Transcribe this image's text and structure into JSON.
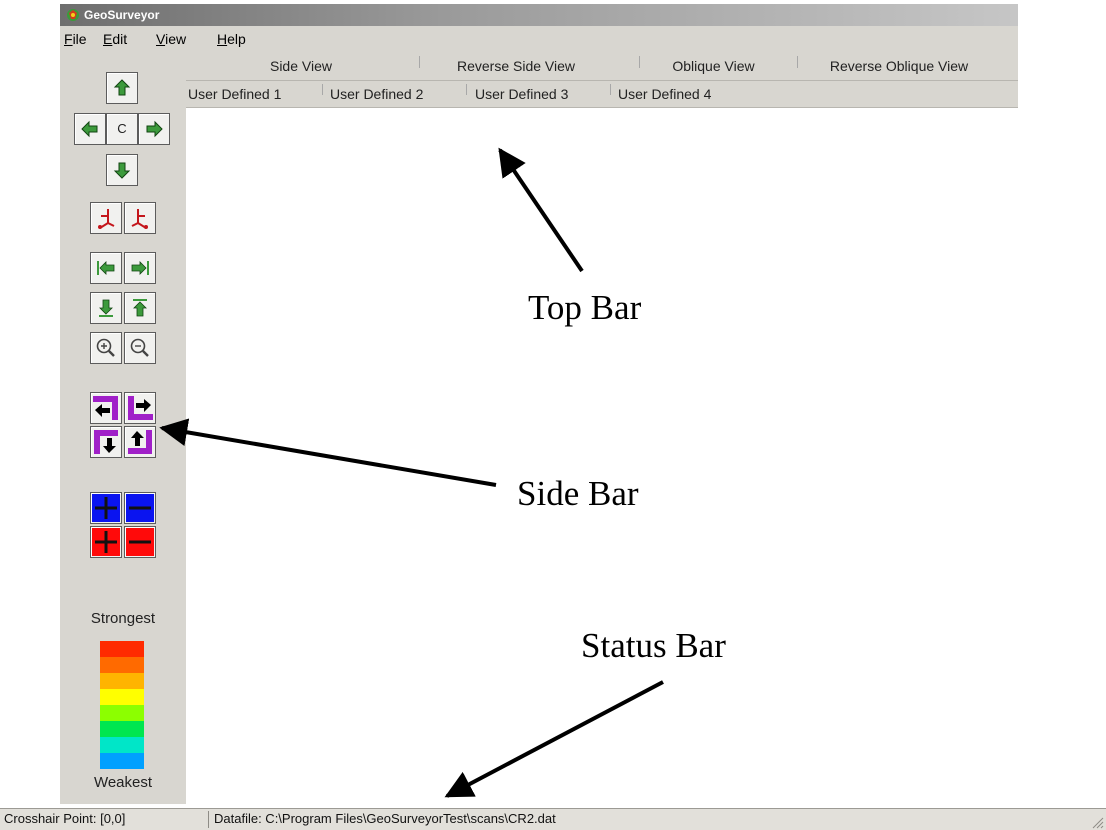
{
  "window": {
    "title": "GeoSurveyor"
  },
  "menu": {
    "items": [
      {
        "hotkey": "F",
        "rest": "ile"
      },
      {
        "hotkey": "E",
        "rest": "dit"
      },
      {
        "hotkey": "V",
        "rest": "iew"
      },
      {
        "hotkey": "H",
        "rest": "elp"
      }
    ]
  },
  "sidebar": {
    "center_label": "C",
    "legend": {
      "top_label": "Strongest",
      "bottom_label": "Weakest",
      "colors": [
        "#ff2a00",
        "#ff6a00",
        "#ffb400",
        "#ffff00",
        "#8cff00",
        "#00e650",
        "#00e6c8",
        "#00a0ff",
        "#0030ff"
      ]
    },
    "intensity_colors": {
      "blue": "#0a14f0",
      "red": "#ff0a0a"
    },
    "shift_color": "#a020c8",
    "icons": [
      "up-arrow-icon",
      "left-arrow-icon",
      "right-arrow-icon",
      "down-arrow-icon",
      "rotate-left-icon",
      "rotate-right-icon",
      "first-scan-icon",
      "last-scan-icon",
      "move-down-icon",
      "move-up-icon",
      "zoom-in-icon",
      "zoom-out-icon",
      "shift-left-icon",
      "shift-right-icon",
      "shift-down-icon",
      "shift-up-icon",
      "blue-plus-icon",
      "blue-minus-icon",
      "red-plus-icon",
      "red-minus-icon"
    ]
  },
  "view_tabs": [
    "Side View",
    "Reverse Side View",
    "Oblique View",
    "Reverse Oblique View"
  ],
  "user_tabs": [
    "User Defined 1",
    "User Defined 2",
    "User Defined 3",
    "User Defined 4"
  ],
  "status": {
    "crosshair": "Crosshair Point: [0,0]",
    "datafile": "Datafile: C:\\Program Files\\GeoSurveyorTest\\scans\\CR2.dat"
  },
  "annotations": {
    "top_bar": "Top Bar",
    "side_bar": "Side Bar",
    "status_bar": "Status Bar"
  }
}
